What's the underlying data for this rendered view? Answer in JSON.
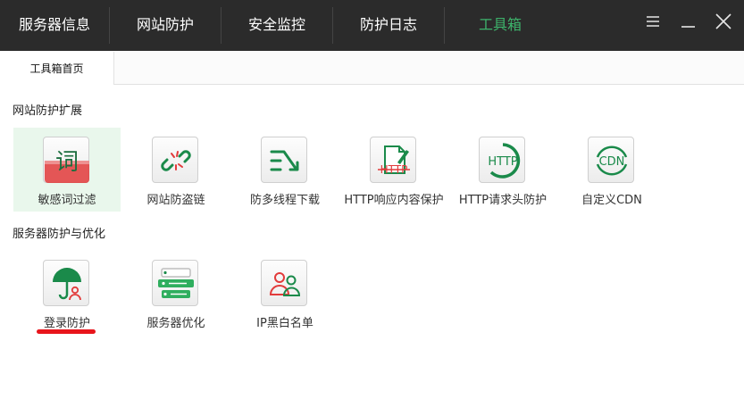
{
  "nav": {
    "items": [
      "服务器信息",
      "网站防护",
      "安全监控",
      "防护日志",
      "工具箱"
    ],
    "active_index": 4
  },
  "tabs": [
    "工具箱首页"
  ],
  "sections": [
    {
      "title": "网站防护扩展",
      "tools": [
        {
          "label": "敏感词过滤",
          "icon": "word-filter-icon",
          "selected": true
        },
        {
          "label": "网站防盗链",
          "icon": "broken-link-icon"
        },
        {
          "label": "防多线程下载",
          "icon": "multithread-download-icon"
        },
        {
          "label": "HTTP响应内容保护",
          "icon": "http-response-icon"
        },
        {
          "label": "HTTP请求头防护",
          "icon": "http-header-icon"
        },
        {
          "label": "自定义CDN",
          "icon": "cdn-icon"
        }
      ]
    },
    {
      "title": "服务器防护与优化",
      "tools": [
        {
          "label": "登录防护",
          "icon": "login-protect-icon"
        },
        {
          "label": "服务器优化",
          "icon": "server-optimize-icon"
        },
        {
          "label": "IP黑白名单",
          "icon": "ip-list-icon"
        }
      ]
    }
  ],
  "icon_text": {
    "word": "词",
    "http_strike": "HTTP",
    "http": "HTTP",
    "cdn": "CDN"
  },
  "colors": {
    "topbar": "#2b2b2b",
    "active_nav": "#3db36b",
    "brand_green": "#1a8a4a",
    "accent_red": "#e8151c"
  }
}
